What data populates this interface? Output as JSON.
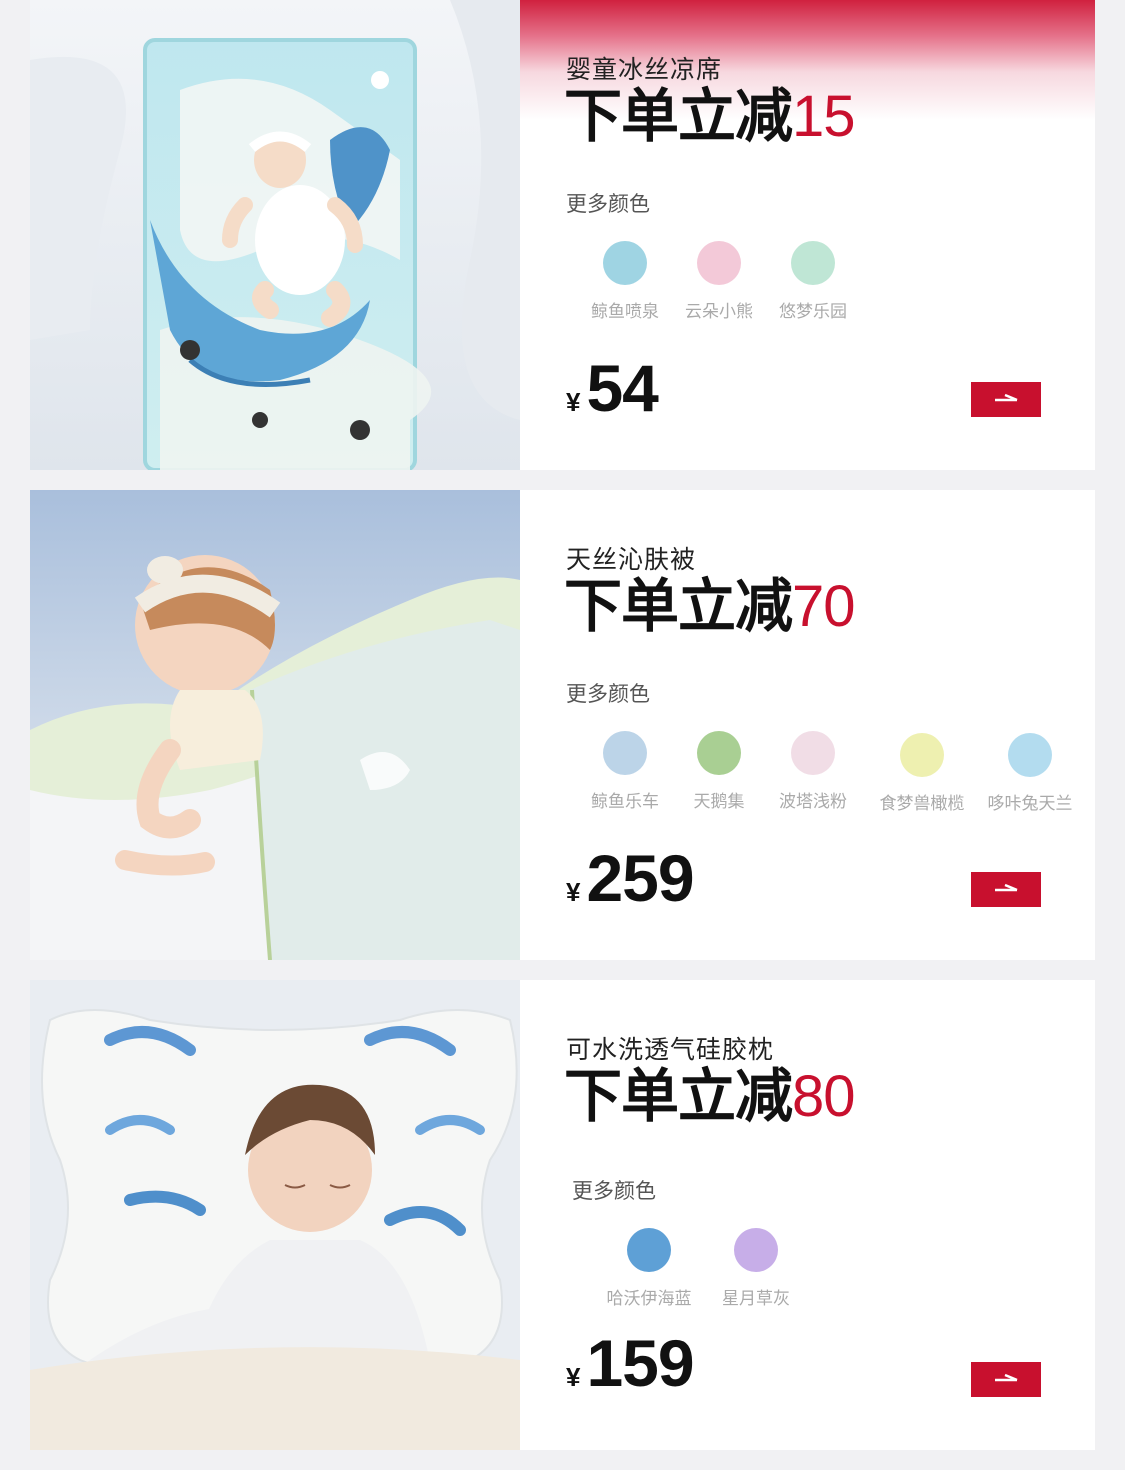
{
  "products": [
    {
      "name": "婴童冰丝凉席",
      "discount_prefix": "下单立减",
      "discount_amount": "15",
      "more_colors_label": "更多颜色",
      "colors": [
        {
          "label": "鲸鱼喷泉",
          "hex": "#9fd4e3"
        },
        {
          "label": "云朵小熊",
          "hex": "#f3c9d8"
        },
        {
          "label": "悠梦乐园",
          "hex": "#bfe6d5"
        }
      ],
      "currency": "¥",
      "price": "54"
    },
    {
      "name": "天丝沁肤被",
      "discount_prefix": "下单立减",
      "discount_amount": "70",
      "more_colors_label": "更多颜色",
      "colors": [
        {
          "label": "鲸鱼乐车",
          "hex": "#bcd4e8"
        },
        {
          "label": "天鹅集",
          "hex": "#a9cf93"
        },
        {
          "label": "波塔浅粉",
          "hex": "#f1dde6"
        },
        {
          "label": "食梦兽橄榄",
          "hex": "#eef0b0"
        },
        {
          "label": "哆咔兔天兰",
          "hex": "#b3dcef"
        }
      ],
      "currency": "¥",
      "price": "259"
    },
    {
      "name": "可水洗透气硅胶枕",
      "discount_prefix": "下单立减",
      "discount_amount": "80",
      "more_colors_label": "更多颜色",
      "colors": [
        {
          "label": "哈沃伊海蓝",
          "hex": "#5ea0d6"
        },
        {
          "label": "星月草灰",
          "hex": "#c7aee8"
        }
      ],
      "currency": "¥",
      "price": "159"
    }
  ],
  "accent_color": "#c8102e"
}
